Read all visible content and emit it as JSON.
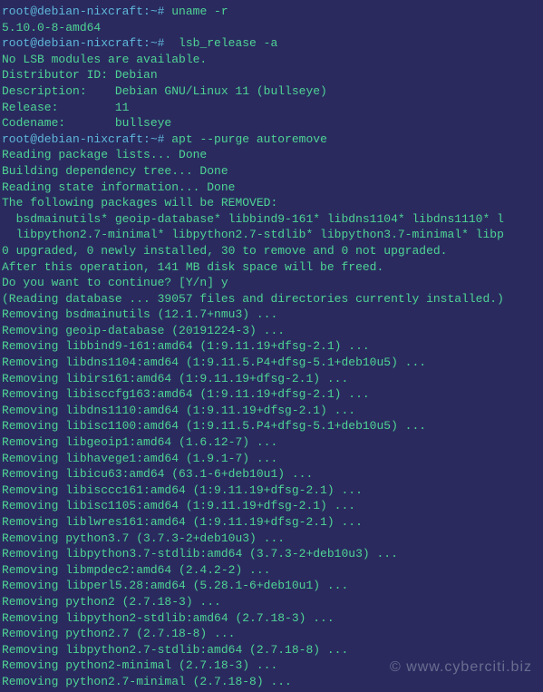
{
  "lines": [
    {
      "prompt": "root@debian-nixcraft:~#",
      "cmd": " uname -r"
    },
    {
      "text": "5.10.0-8-amd64"
    },
    {
      "prompt": "root@debian-nixcraft:~#",
      "cmd": "  lsb_release -a"
    },
    {
      "text": "No LSB modules are available."
    },
    {
      "text": "Distributor ID: Debian"
    },
    {
      "text": "Description:    Debian GNU/Linux 11 (bullseye)"
    },
    {
      "text": "Release:        11"
    },
    {
      "text": "Codename:       bullseye"
    },
    {
      "prompt": "root@debian-nixcraft:~#",
      "cmd": " apt --purge autoremove"
    },
    {
      "text": "Reading package lists... Done"
    },
    {
      "text": "Building dependency tree... Done"
    },
    {
      "text": "Reading state information... Done"
    },
    {
      "text": "The following packages will be REMOVED:"
    },
    {
      "text": "  bsdmainutils* geoip-database* libbind9-161* libdns1104* libdns1110* l"
    },
    {
      "text": "  libpython2.7-minimal* libpython2.7-stdlib* libpython3.7-minimal* libp"
    },
    {
      "text": "0 upgraded, 0 newly installed, 30 to remove and 0 not upgraded."
    },
    {
      "text": "After this operation, 141 MB disk space will be freed."
    },
    {
      "text": "Do you want to continue? [Y/n] y"
    },
    {
      "text": "(Reading database ... 39057 files and directories currently installed.)"
    },
    {
      "text": "Removing bsdmainutils (12.1.7+nmu3) ..."
    },
    {
      "text": "Removing geoip-database (20191224-3) ..."
    },
    {
      "text": "Removing libbind9-161:amd64 (1:9.11.19+dfsg-2.1) ..."
    },
    {
      "text": "Removing libdns1104:amd64 (1:9.11.5.P4+dfsg-5.1+deb10u5) ..."
    },
    {
      "text": "Removing libirs161:amd64 (1:9.11.19+dfsg-2.1) ..."
    },
    {
      "text": "Removing libisccfg163:amd64 (1:9.11.19+dfsg-2.1) ..."
    },
    {
      "text": "Removing libdns1110:amd64 (1:9.11.19+dfsg-2.1) ..."
    },
    {
      "text": "Removing libisc1100:amd64 (1:9.11.5.P4+dfsg-5.1+deb10u5) ..."
    },
    {
      "text": "Removing libgeoip1:amd64 (1.6.12-7) ..."
    },
    {
      "text": "Removing libhavege1:amd64 (1.9.1-7) ..."
    },
    {
      "text": "Removing libicu63:amd64 (63.1-6+deb10u1) ..."
    },
    {
      "text": "Removing libisccc161:amd64 (1:9.11.19+dfsg-2.1) ..."
    },
    {
      "text": "Removing libisc1105:amd64 (1:9.11.19+dfsg-2.1) ..."
    },
    {
      "text": "Removing liblwres161:amd64 (1:9.11.19+dfsg-2.1) ..."
    },
    {
      "text": "Removing python3.7 (3.7.3-2+deb10u3) ..."
    },
    {
      "text": "Removing libpython3.7-stdlib:amd64 (3.7.3-2+deb10u3) ..."
    },
    {
      "text": "Removing libmpdec2:amd64 (2.4.2-2) ..."
    },
    {
      "text": "Removing libperl5.28:amd64 (5.28.1-6+deb10u1) ..."
    },
    {
      "text": "Removing python2 (2.7.18-3) ..."
    },
    {
      "text": "Removing libpython2-stdlib:amd64 (2.7.18-3) ..."
    },
    {
      "text": "Removing python2.7 (2.7.18-8) ..."
    },
    {
      "text": "Removing libpython2.7-stdlib:amd64 (2.7.18-8) ..."
    },
    {
      "text": "Removing python2-minimal (2.7.18-3) ..."
    },
    {
      "text": "Removing python2.7-minimal (2.7.18-8) ..."
    }
  ],
  "watermark": "©  www.cyberciti.biz"
}
